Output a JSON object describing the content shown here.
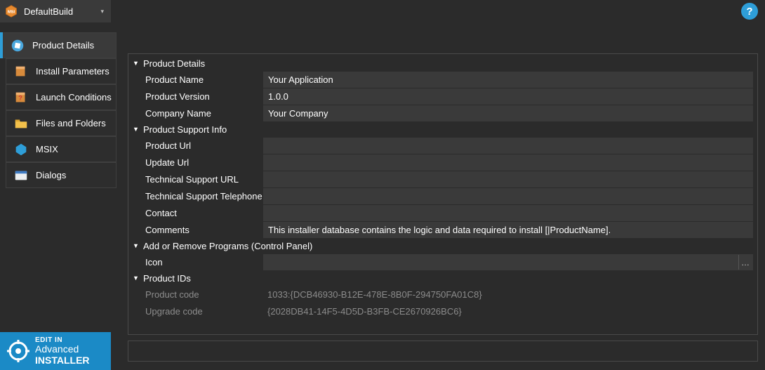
{
  "topbar": {
    "build_label": "DefaultBuild"
  },
  "sidebar": {
    "items": [
      {
        "label": "Product Details"
      },
      {
        "label": "Install Parameters"
      },
      {
        "label": "Launch Conditions"
      },
      {
        "label": "Files and Folders"
      },
      {
        "label": "MSIX"
      },
      {
        "label": "Dialogs"
      }
    ]
  },
  "edit_in": {
    "line1": "EDIT IN",
    "line2": "Advanced",
    "line3": "INSTALLER"
  },
  "sections": {
    "product_details": {
      "title": "Product Details",
      "rows": {
        "product_name": {
          "label": "Product Name",
          "value": "Your Application"
        },
        "product_version": {
          "label": "Product Version",
          "value": "1.0.0"
        },
        "company_name": {
          "label": "Company Name",
          "value": "Your Company"
        }
      }
    },
    "support_info": {
      "title": "Product Support Info",
      "rows": {
        "product_url": {
          "label": "Product Url",
          "value": ""
        },
        "update_url": {
          "label": "Update Url",
          "value": ""
        },
        "support_url": {
          "label": "Technical Support URL",
          "value": ""
        },
        "support_tel": {
          "label": "Technical Support Telephone",
          "value": ""
        },
        "contact": {
          "label": "Contact",
          "value": ""
        },
        "comments": {
          "label": "Comments",
          "value": "This installer database contains the logic and data required to install [|ProductName]."
        }
      }
    },
    "arp": {
      "title": "Add or Remove Programs (Control Panel)",
      "rows": {
        "icon": {
          "label": "Icon",
          "value": "",
          "browse": "…"
        }
      }
    },
    "product_ids": {
      "title": "Product IDs",
      "rows": {
        "product_code": {
          "label": "Product code",
          "value": "1033:{DCB46930-B12E-478E-8B0F-294750FA01C8}"
        },
        "upgrade_code": {
          "label": "Upgrade code",
          "value": "{2028DB41-14F5-4D5D-B3FB-CE2670926BC6}"
        }
      }
    }
  }
}
